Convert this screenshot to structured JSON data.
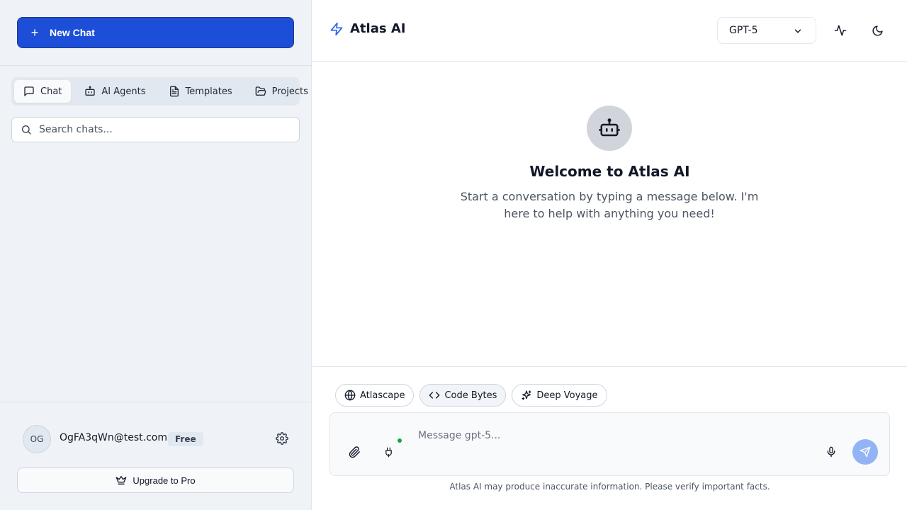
{
  "sidebar": {
    "new_chat_label": "New Chat",
    "tabs": [
      {
        "label": "Chat",
        "icon": "message-square-icon",
        "active": true
      },
      {
        "label": "AI Agents",
        "icon": "bot-icon",
        "active": false
      },
      {
        "label": "Templates",
        "icon": "file-text-icon",
        "active": false
      },
      {
        "label": "Projects",
        "icon": "folder-icon",
        "active": false
      }
    ],
    "search_placeholder": "Search chats...",
    "user": {
      "initials": "OG",
      "email": "OgFA3qWn@test.com",
      "plan": "Free"
    },
    "upgrade_label": "Upgrade to Pro"
  },
  "header": {
    "app_name": "Atlas AI",
    "model": "GPT-5"
  },
  "welcome": {
    "title": "Welcome to Atlas AI",
    "subtitle": "Start a conversation by typing a message below. I'm here to help with anything you need!"
  },
  "composer": {
    "modes": [
      {
        "label": "Atlascape",
        "icon": "globe-icon",
        "active": false
      },
      {
        "label": "Code Bytes",
        "icon": "code-icon",
        "active": true
      },
      {
        "label": "Deep Voyage",
        "icon": "sparkles-icon",
        "active": false
      }
    ],
    "placeholder": "Message gpt-5..."
  },
  "disclaimer": "Atlas AI may produce inaccurate information. Please verify important facts.",
  "colors": {
    "primary": "#1d4ed8",
    "send_disabled": "#93b4f4",
    "status_online": "#16a34a",
    "sidebar_bg": "#eff3f8"
  }
}
